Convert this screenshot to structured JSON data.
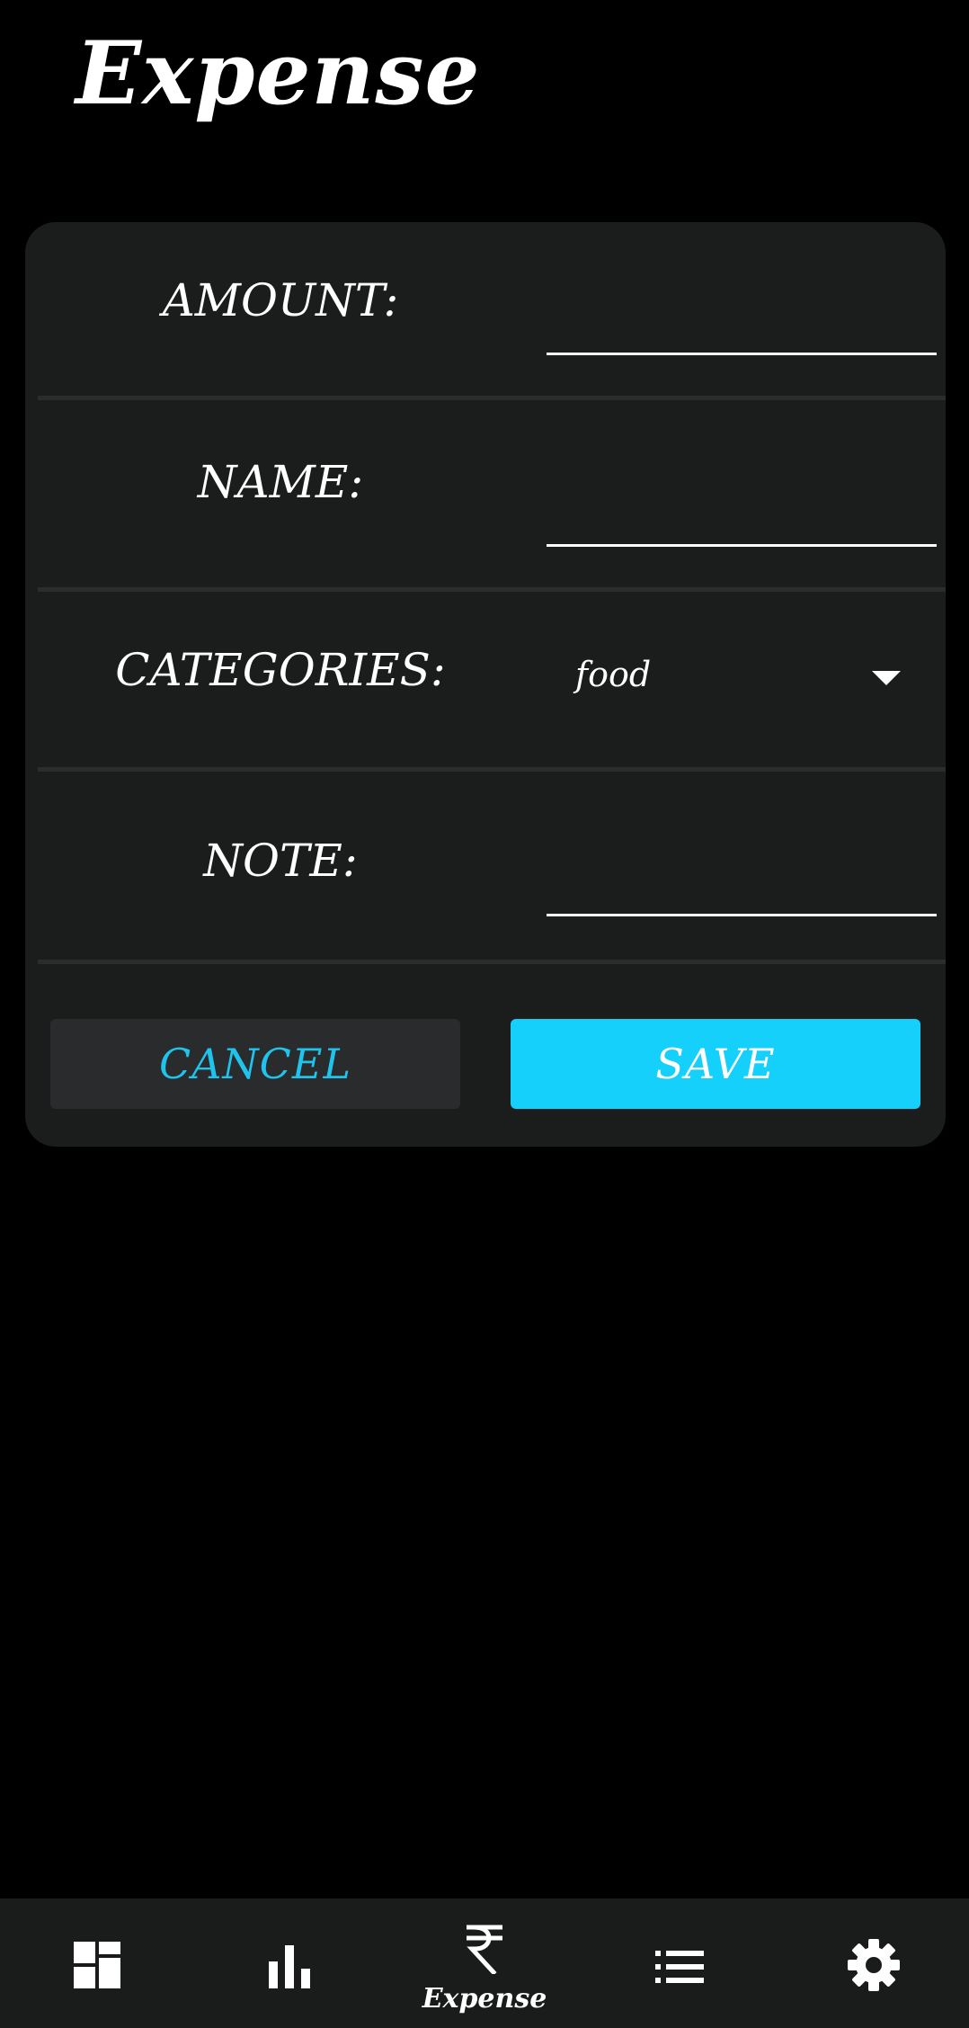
{
  "header": {
    "title": "Expense"
  },
  "form": {
    "amount_label": "AMOUNT:",
    "amount_value": "",
    "name_label": "NAME:",
    "name_value": "",
    "categories_label": "CATEGORIES:",
    "categories_selected": "food",
    "note_label": "NOTE:",
    "note_value": ""
  },
  "actions": {
    "cancel_label": "CANCEL",
    "save_label": "SAVE"
  },
  "bottom_nav": {
    "items": [
      {
        "icon": "dashboard-icon",
        "label": ""
      },
      {
        "icon": "bar-chart-icon",
        "label": ""
      },
      {
        "icon": "rupee-icon",
        "label": "Expense"
      },
      {
        "icon": "list-icon",
        "label": ""
      },
      {
        "icon": "gear-icon",
        "label": ""
      }
    ]
  },
  "colors": {
    "background": "#000000",
    "card": "#1b1c1c",
    "accent": "#16d0fc",
    "cancel_text": "#1fc3ec",
    "nav_background": "#1a1b1b"
  }
}
